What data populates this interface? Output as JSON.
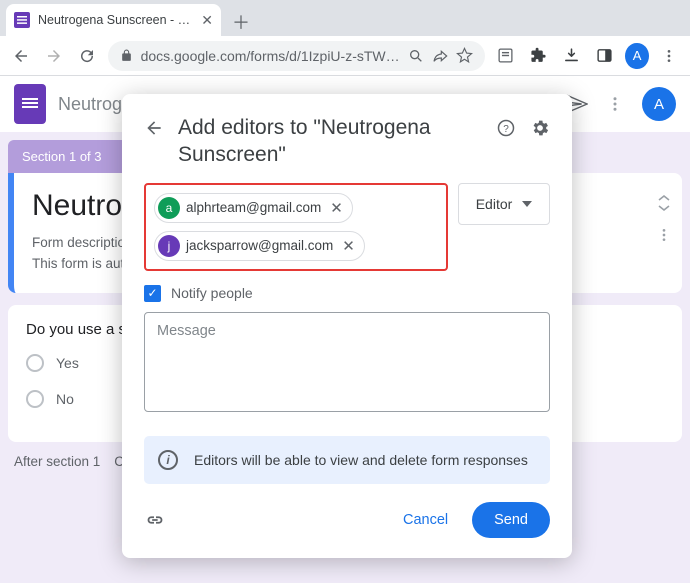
{
  "window": {
    "tab_title": "Neutrogena Sunscreen - Google",
    "url": "docs.google.com/forms/d/1IzpiU-z-sTW…",
    "avatar_letter": "A"
  },
  "forms_header": {
    "doc_title": "Neutrog",
    "avatar_letter": "A"
  },
  "background": {
    "section_label": "Section 1 of 3",
    "form_title": "Neutrog",
    "desc_label": "Form description",
    "auto_text": "This form is auto",
    "question": "Do you use a su",
    "option_yes": "Yes",
    "option_no": "No",
    "after_label": "After section 1",
    "continue_label": "Continue to next section"
  },
  "modal": {
    "title": "Add editors to \"Neutrogena Sunscreen\"",
    "chips": [
      {
        "initial": "a",
        "email": "alphrteam@gmail.com",
        "color": "green"
      },
      {
        "initial": "j",
        "email": "jacksparrow@gmail.com",
        "color": "purple"
      }
    ],
    "role_label": "Editor",
    "notify_label": "Notify people",
    "message_placeholder": "Message",
    "info_text": "Editors will be able to view and delete form responses",
    "cancel_label": "Cancel",
    "send_label": "Send"
  }
}
